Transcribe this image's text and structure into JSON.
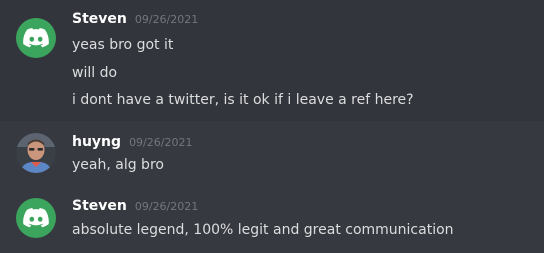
{
  "colors": {
    "background": "#36393f",
    "hover_background": "#32353b",
    "username": "#ffffff",
    "text": "#dcddde",
    "timestamp": "#72767d",
    "discord_avatar": "#3ba55d"
  },
  "messages": [
    {
      "author": "Steven",
      "timestamp": "09/26/2021",
      "avatar_icon": "discord-logo-icon",
      "lines": [
        "yeas bro got it",
        "will do",
        "i dont have a twitter, is it ok if i leave a ref here?"
      ]
    },
    {
      "author": "huyng",
      "timestamp": "09/26/2021",
      "avatar_icon": "user-photo-avatar",
      "lines": [
        "yeah, alg bro"
      ]
    },
    {
      "author": "Steven",
      "timestamp": "09/26/2021",
      "avatar_icon": "discord-logo-icon",
      "lines": [
        "absolute legend, 100% legit and great communication"
      ]
    }
  ]
}
